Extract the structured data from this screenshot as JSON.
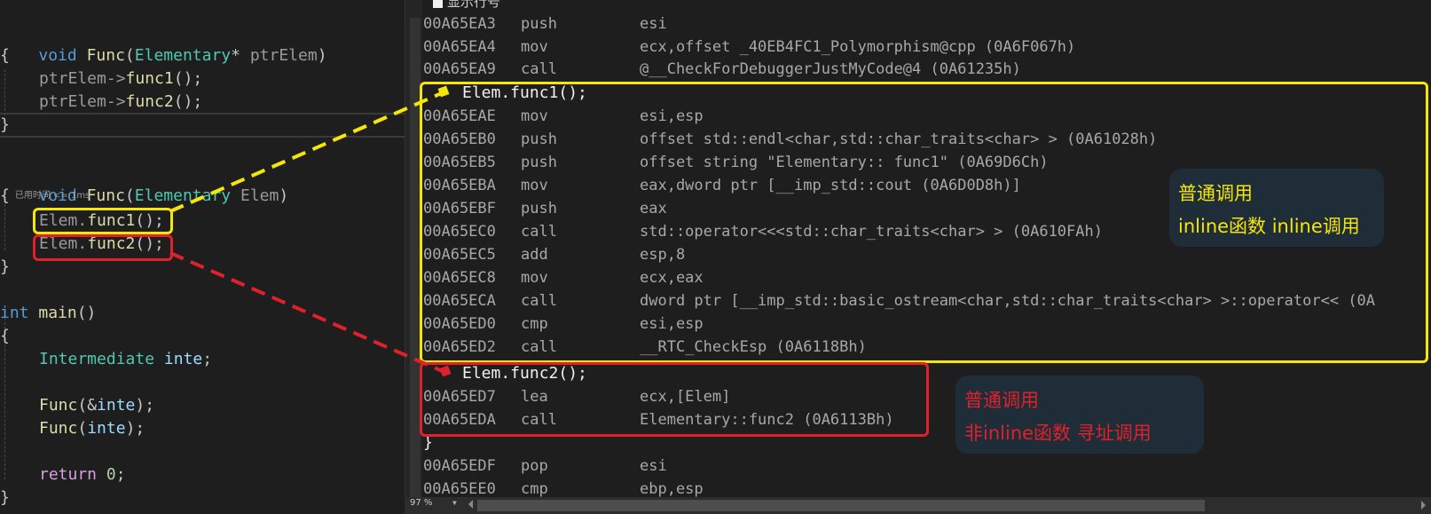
{
  "source_editor": {
    "func_ptr": {
      "signature": {
        "kw": "void",
        "name": "Func",
        "open": "(",
        "type": "Elementary",
        "ptr": "*",
        "param": " ptrElem",
        "close": ")"
      },
      "open_brace": "{",
      "lines": [
        {
          "obj": "ptrElem->",
          "method": "func1",
          "rest": "();"
        },
        {
          "obj": "ptrElem->",
          "method": "func2",
          "rest": "();"
        }
      ],
      "close_brace": "}"
    },
    "func_val": {
      "signature": {
        "kw": "void",
        "name": "Func",
        "open": "(",
        "type": "Elementary",
        "param": " Elem",
        "close": ")"
      },
      "open_brace": "{",
      "codelens": "已用时间 <= 1ms",
      "lines": [
        {
          "obj": "Elem.",
          "method": "func1",
          "rest": "();"
        },
        {
          "obj": "Elem.",
          "method": "func2",
          "rest": "();"
        }
      ],
      "close_brace": "}"
    },
    "main": {
      "signature": {
        "kw": "int",
        "name": "main",
        "rest": "()"
      },
      "open_brace": "{",
      "decl": {
        "type": "Intermediate",
        "var": "inte",
        "end": ";"
      },
      "call1": {
        "name": "Func",
        "open": "(&",
        "arg": "inte",
        "end": ");"
      },
      "call2": {
        "name": "Func",
        "open": "(",
        "arg": "inte",
        "end": ");"
      },
      "ret": {
        "kw": "return",
        "value": "0",
        "end": ";"
      },
      "close_brace": "}"
    }
  },
  "disassembly": {
    "options_label": "显示行号",
    "pre_lines": [
      {
        "addr": "00A65EA3",
        "op": "push",
        "arg": "esi"
      },
      {
        "addr": "00A65EA4",
        "op": "mov",
        "arg": "ecx,offset _40EB4FC1_Polymorphism@cpp (0A6F067h)"
      },
      {
        "addr": "00A65EA9",
        "op": "call",
        "arg": "@__CheckForDebuggerJustMyCode@4 (0A61235h)"
      }
    ],
    "func1_source": "Elem.func1();",
    "func1_lines": [
      {
        "addr": "00A65EAE",
        "op": "mov",
        "arg": "esi,esp"
      },
      {
        "addr": "00A65EB0",
        "op": "push",
        "arg": "offset std::endl<char,std::char_traits<char> > (0A61028h)"
      },
      {
        "addr": "00A65EB5",
        "op": "push",
        "arg": "offset string \"Elementary:: func1\" (0A69D6Ch)"
      },
      {
        "addr": "00A65EBA",
        "op": "mov",
        "arg": "eax,dword ptr [__imp_std::cout (0A6D0D8h)]"
      },
      {
        "addr": "00A65EBF",
        "op": "push",
        "arg": "eax"
      },
      {
        "addr": "00A65EC0",
        "op": "call",
        "arg": "std::operator<<<std::char_traits<char> > (0A610FAh)"
      },
      {
        "addr": "00A65EC5",
        "op": "add",
        "arg": "esp,8"
      },
      {
        "addr": "00A65EC8",
        "op": "mov",
        "arg": "ecx,eax"
      },
      {
        "addr": "00A65ECA",
        "op": "call",
        "arg": "dword ptr [__imp_std::basic_ostream<char,std::char_traits<char> >::operator<< (0A"
      },
      {
        "addr": "00A65ED0",
        "op": "cmp",
        "arg": "esi,esp"
      },
      {
        "addr": "00A65ED2",
        "op": "call",
        "arg": "__RTC_CheckEsp (0A6118Bh)"
      }
    ],
    "func2_source": "Elem.func2();",
    "func2_lines": [
      {
        "addr": "00A65ED7",
        "op": "lea",
        "arg": "ecx,[Elem]"
      },
      {
        "addr": "00A65EDA",
        "op": "call",
        "arg": "Elementary::func2 (0A6113Bh)"
      }
    ],
    "close_brace": "}",
    "post_lines": [
      {
        "addr": "00A65EDF",
        "op": "pop",
        "arg": "esi"
      },
      {
        "addr": "00A65EE0",
        "op": "cmp",
        "arg": "ebp,esp"
      }
    ],
    "zoom_level": "97 %"
  },
  "annotations": {
    "inline_note": {
      "line1": "普通调用",
      "line2": "inline函数 inline调用",
      "color": "#f5e60a"
    },
    "noninline_note": {
      "line1": "普通调用",
      "line2": "非inline函数 寻址调用",
      "color": "#e0202a"
    },
    "box_bg": "#1e2d38"
  },
  "colors": {
    "background": "#1e1e1e",
    "keyword": "#569cd6",
    "function": "#dcdcaa",
    "type": "#4ec9b0",
    "variable": "#9cdcfe",
    "control": "#d8a0df",
    "highlight_yellow": "#f5e60a",
    "highlight_red": "#e0202a"
  }
}
